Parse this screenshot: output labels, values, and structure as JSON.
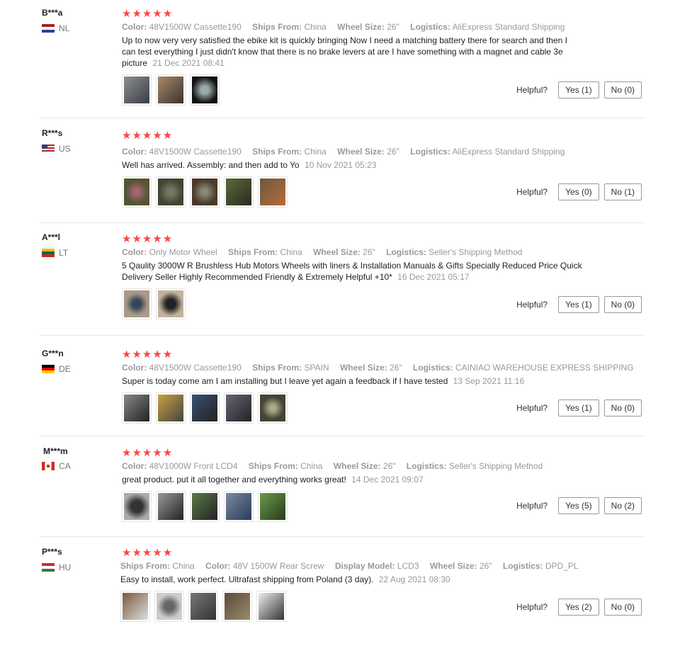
{
  "helpful_label": "Helpful?",
  "reviews": [
    {
      "user": "B***a",
      "country": "NL",
      "stars": "★★★★★",
      "meta": [
        [
          "Color:",
          "48V1500W Cassette190"
        ],
        [
          "Ships From:",
          "China"
        ],
        [
          "Wheel Size:",
          "26\""
        ],
        [
          "Logistics:",
          "AliExpress Standard Shipping"
        ]
      ],
      "text": "Up to now very very satisfied the ebike kit is quickly bringing Now I need a matching battery there for search and then I can test everything I just didn't know that there is no brake levers at are I have something with a magnet and cable 3e picture",
      "date": "21 Dec 2021 08:41",
      "yes": "Yes (1)",
      "no": "No (0)"
    },
    {
      "user": "R***s",
      "country": "US",
      "stars": "★★★★★",
      "meta": [
        [
          "Color:",
          "48V1500W Cassette190"
        ],
        [
          "Ships From:",
          "China"
        ],
        [
          "Wheel Size:",
          "26\""
        ],
        [
          "Logistics:",
          "AliExpress Standard Shipping"
        ]
      ],
      "text": "Well has arrived. Assembly: and then add to Yo",
      "date": "10 Nov 2021 05:23",
      "yes": "Yes (0)",
      "no": "No (1)"
    },
    {
      "user": "A***l",
      "country": "LT",
      "stars": "★★★★★",
      "meta": [
        [
          "Color:",
          "Only Motor Wheel"
        ],
        [
          "Ships From:",
          "China"
        ],
        [
          "Wheel Size:",
          "26\""
        ],
        [
          "Logistics:",
          "Seller's Shipping Method"
        ]
      ],
      "text": "5 Qaulity 3000W R Brushless Hub Motors Wheels with liners & Installation Manuals & Gifts Specially Reduced Price Quick Delivery Seller Highly Recommended Friendly & Extremely Helpful +10*",
      "date": "16 Dec 2021 05:17",
      "yes": "Yes (1)",
      "no": "No (0)"
    },
    {
      "user": "G***n",
      "country": "DE",
      "stars": "★★★★★",
      "meta": [
        [
          "Color:",
          "48V1500W Cassette190"
        ],
        [
          "Ships From:",
          "SPAIN"
        ],
        [
          "Wheel Size:",
          "26\""
        ],
        [
          "Logistics:",
          "CAINIAO WAREHOUSE EXPRESS SHIPPING"
        ]
      ],
      "text": "Super is today come am I am installing but I leave yet again a feedback if I have tested",
      "date": "13 Sep 2021 11:16",
      "yes": "Yes (1)",
      "no": "No (0)"
    },
    {
      "user": "M***m",
      "country": "CA",
      "stars": "★★★★★",
      "meta": [
        [
          "Color:",
          "48V1000W Front LCD4"
        ],
        [
          "Ships From:",
          "China"
        ],
        [
          "Wheel Size:",
          "26\""
        ],
        [
          "Logistics:",
          "Seller's Shipping Method"
        ]
      ],
      "text": "great product. put it all together and everything works great!",
      "date": "14 Dec 2021 09:07",
      "yes": "Yes (5)",
      "no": "No (2)"
    },
    {
      "user": "P***s",
      "country": "HU",
      "stars": "★★★★★",
      "meta": [
        [
          "Ships From:",
          "China"
        ],
        [
          "Color:",
          "48V 1500W Rear Screw"
        ],
        [
          "Display Model:",
          "LCD3"
        ],
        [
          "Wheel Size:",
          "26\""
        ],
        [
          "Logistics:",
          "DPD_PL"
        ]
      ],
      "text": "Easy to install, work perfect. Ultrafast shipping from Poland (3 day).",
      "date": "22 Aug 2021 08:30",
      "yes": "Yes (2)",
      "no": "No (0)"
    }
  ]
}
